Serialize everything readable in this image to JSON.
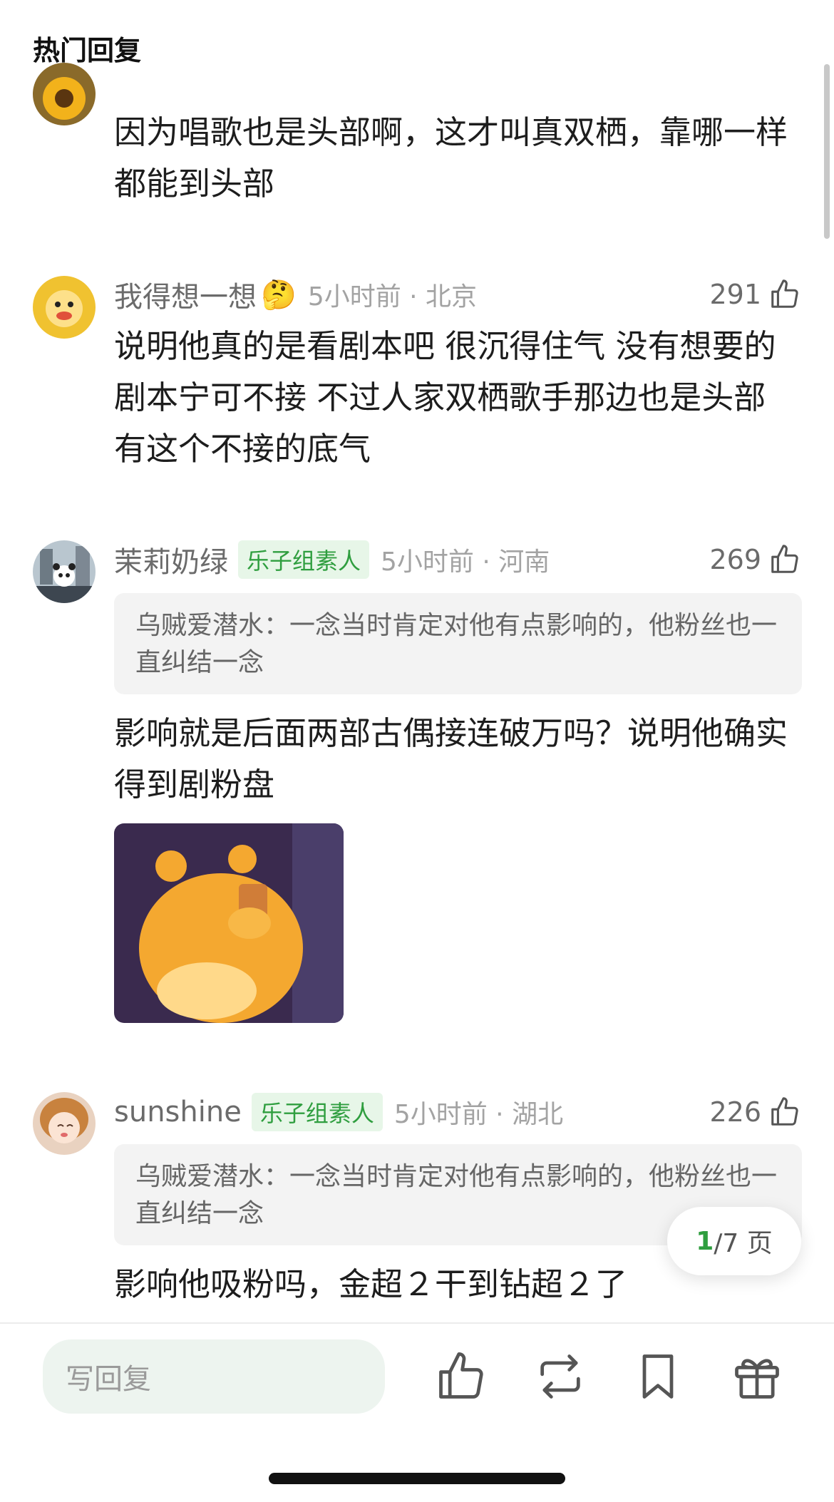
{
  "header": {
    "title": "热门回复"
  },
  "comments": [
    {
      "text": "因为唱歌也是头部啊，这才叫真双栖，靠哪一样都能到头部"
    },
    {
      "name": "我得想一想",
      "emoji": "🤔",
      "time": "5小时前 · 北京",
      "likes": "291",
      "text": "说明他真的是看剧本吧 很沉得住气 没有想要的剧本宁可不接 不过人家双栖歌手那边也是头部 有这个不接的底气"
    },
    {
      "name": "茉莉奶绿",
      "badge": "乐子组素人",
      "time": "5小时前 · 河南",
      "likes": "269",
      "quote": "乌贼爱潜水：一念当时肯定对他有点影响的，他粉丝也一直纠结一念",
      "text": "影响就是后面两部古偶接连破万吗？说明他确实得到剧粉盘"
    },
    {
      "name": "sunshine",
      "badge": "乐子组素人",
      "time": "5小时前 · 湖北",
      "likes": "226",
      "quote": "乌贼爱潜水：一念当时肯定对他有点影响的，他粉丝也一直纠结一念",
      "text": "影响他吸粉吗，金超２干到钻超２了"
    }
  ],
  "pager": {
    "current": "1",
    "rest": "/7 页"
  },
  "bottom_bar": {
    "reply_placeholder": "写回复"
  },
  "colors": {
    "accent_green": "#2f9e3f",
    "badge_bg": "#e7f6e8"
  },
  "icons": [
    "thumbs-up-icon",
    "repost-icon",
    "bookmark-icon",
    "gift-icon"
  ]
}
